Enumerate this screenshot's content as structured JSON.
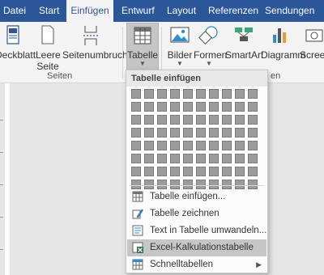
{
  "tabs": [
    {
      "label": "Datei"
    },
    {
      "label": "Start"
    },
    {
      "label": "Einfügen"
    },
    {
      "label": "Entwurf"
    },
    {
      "label": "Layout"
    },
    {
      "label": "Referenzen"
    },
    {
      "label": "Sendungen"
    }
  ],
  "active_tab": "Einfügen",
  "ribbon": {
    "deckblatt": "Deckblatt",
    "leere_seite_1": "Leere",
    "leere_seite_2": "Seite",
    "seitenumbruch": "Seitenumbruch",
    "tabelle": "Tabelle",
    "bilder": "Bilder",
    "formen": "Formen",
    "smartart": "SmartArt",
    "diagramm": "Diagramm",
    "screen": "Screen",
    "group_seiten": "Seiten",
    "group_ill": "en"
  },
  "dropdown": {
    "header": "Tabelle einfügen",
    "grid_rows": 8,
    "grid_cols": 10,
    "items": [
      {
        "label": "Tabelle einfügen...",
        "icon": "table-icon"
      },
      {
        "label": "Tabelle zeichnen",
        "icon": "pencil-icon"
      },
      {
        "label": "Text in Tabelle umwandeln...",
        "icon": "convert-icon"
      },
      {
        "label": "Excel-Kalkulationstabelle",
        "icon": "excel-icon"
      },
      {
        "label": "Schnelltabellen",
        "icon": "quick-table-icon",
        "submenu": true
      }
    ]
  },
  "colors": {
    "tabbar": "#2b579a",
    "ribbon": "#f3f3f3",
    "excel_green": "#217346"
  }
}
